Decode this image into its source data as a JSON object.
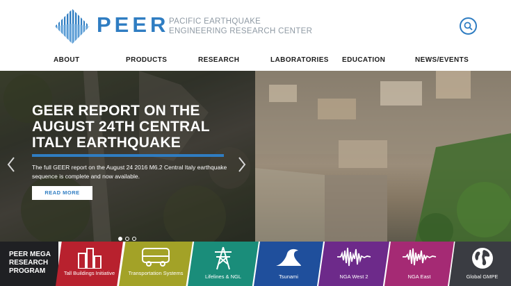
{
  "header": {
    "brand": "PEER",
    "org_line1": "PACIFIC EARTHQUAKE",
    "org_line2": "ENGINEERING RESEARCH CENTER"
  },
  "nav": {
    "items": [
      {
        "label": "ABOUT"
      },
      {
        "label": "PRODUCTS"
      },
      {
        "label": "RESEARCH"
      },
      {
        "label": "LABORATORIES"
      },
      {
        "label": "EDUCATION"
      },
      {
        "label": "NEWS/EVENTS"
      }
    ]
  },
  "hero": {
    "title": "GEER REPORT ON THE AUGUST 24TH CENTRAL ITALY EARTHQUAKE",
    "description": "The full GEER report on the August 24 2016 M6.2 Central Italy earthquake sequence is complete and now available.",
    "button": "READ MORE",
    "slides_total": 3,
    "slide_active": 1
  },
  "strip": {
    "mega_label": "PEER MEGA RESEARCH PROGRAM",
    "tiles": [
      {
        "label": "Tall Buildings Initiative",
        "icon": "tall-buildings-icon",
        "color": "#b8212e"
      },
      {
        "label": "Transportation Systems",
        "icon": "bus-icon",
        "color": "#a3a227"
      },
      {
        "label": "Lifelines & NGL",
        "icon": "power-tower-icon",
        "color": "#1a8d7a"
      },
      {
        "label": "Tsunami",
        "icon": "wave-icon",
        "color": "#1f4f9c"
      },
      {
        "label": "NGA West 2",
        "icon": "seismogram-icon",
        "color": "#6d2a8a"
      },
      {
        "label": "NGA East",
        "icon": "seismogram-icon",
        "color": "#a52a74"
      },
      {
        "label": "Global GMPE",
        "icon": "globe-icon",
        "color": "#3a3c42"
      }
    ]
  },
  "colors": {
    "brand_blue": "#2f7dc2",
    "org_gray": "#8f9aa4"
  }
}
